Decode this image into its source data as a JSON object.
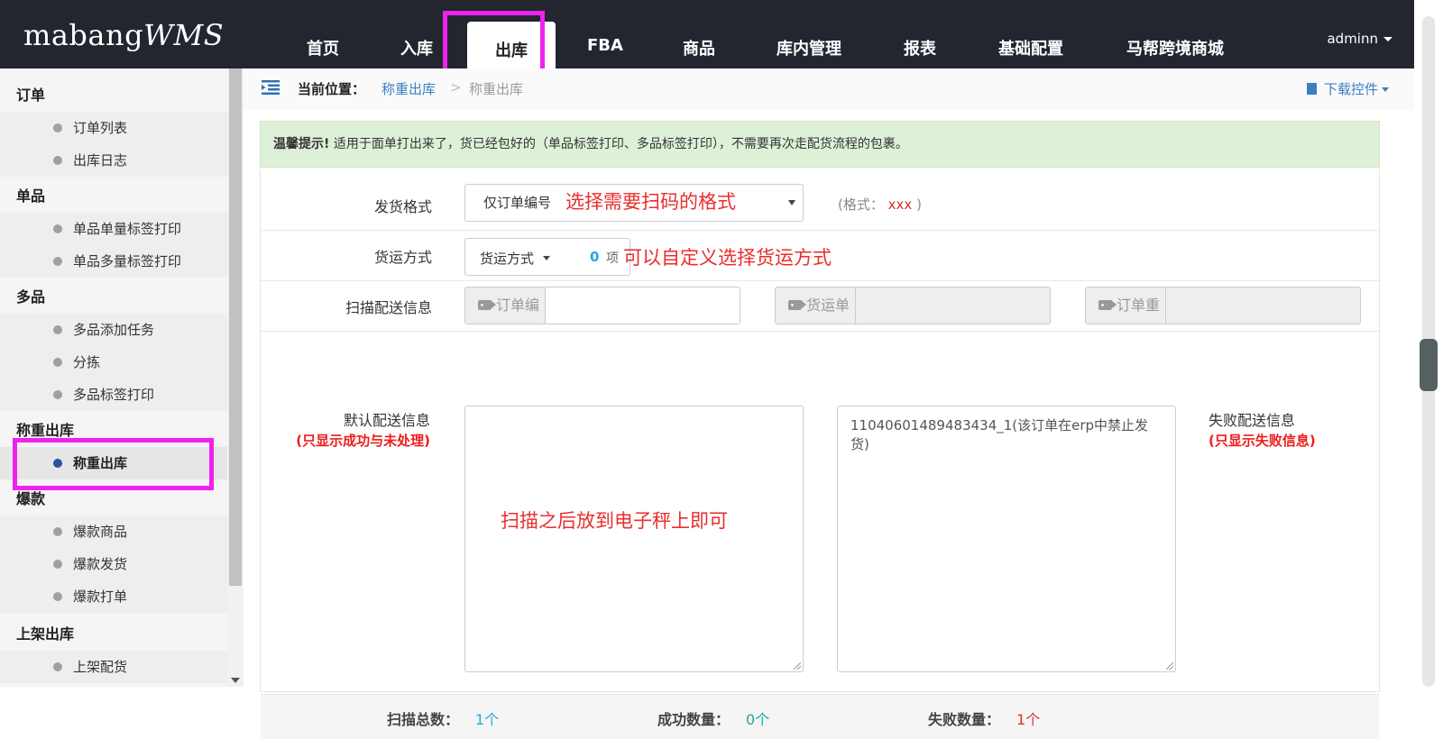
{
  "header": {
    "logo_main": "mabang",
    "logo_wms": "WMS",
    "nav": [
      "首页",
      "入库",
      "出库",
      "FBA",
      "商品",
      "库内管理",
      "报表",
      "基础配置",
      "马帮跨境商城"
    ],
    "user": "adminn"
  },
  "sidebar": {
    "groups": [
      {
        "title": "订单",
        "items": [
          "订单列表",
          "出库日志"
        ]
      },
      {
        "title": "单品",
        "items": [
          "单品单量标签打印",
          "单品多量标签打印"
        ]
      },
      {
        "title": "多品",
        "items": [
          "多品添加任务",
          "分拣",
          "多品标签打印"
        ]
      },
      {
        "title": "称重出库",
        "items": [
          "称重出库"
        ]
      },
      {
        "title": "爆款",
        "items": [
          "爆款商品",
          "爆款发货",
          "爆款打单"
        ]
      },
      {
        "title": "上架出库",
        "items": [
          "上架配货"
        ]
      }
    ]
  },
  "breadcrumb": {
    "label": "当前位置：",
    "link": "称重出库",
    "sep": ">",
    "current": "称重出库",
    "download": "下载控件"
  },
  "alert": {
    "strong": "温馨提示!",
    "text": " 适用于面单打出来了，货已经包好的（单品标签打印、多品标签打印），不需要再次走配货流程的包裹。"
  },
  "form": {
    "format_label": "发货格式",
    "format_value": "仅订单编号",
    "format_hint_prefix": "(格式：",
    "format_hint_value": "xxx",
    "format_hint_suffix": ")",
    "shipping_label": "货运方式",
    "shipping_btn": "货运方式",
    "shipping_count": "0",
    "shipping_unit": "项",
    "scan_label": "扫描配送信息",
    "order_no": "订单编号",
    "tracking_no": "货运单号",
    "order_weight": "订单重量",
    "default_label": "默认配送信息",
    "default_sub": "(只显示成功与未处理)",
    "fail_label": "失败配送信息",
    "fail_sub": "(只显示失败信息)",
    "fail_content": "11040601489483434_1(该订单在erp中禁止发货)"
  },
  "annotations": {
    "format": "选择需要扫码的格式",
    "shipping": "可以自定义选择货运方式",
    "scale": "扫描之后放到电子秤上即可"
  },
  "summary": {
    "total_label": "扫描总数：",
    "total_value": "1个",
    "success_label": "成功数量：",
    "success_value": "0个",
    "fail_label": "失败数量：",
    "fail_value": "1个"
  },
  "colors": {
    "header_bg": "#23262f",
    "link": "#3a7fc1",
    "alert_bg": "#dff0d8",
    "annotation": "#ea2e2e",
    "highlight_box": "#ee22ee",
    "success": "#1aa6a6",
    "fail": "#e03030"
  }
}
